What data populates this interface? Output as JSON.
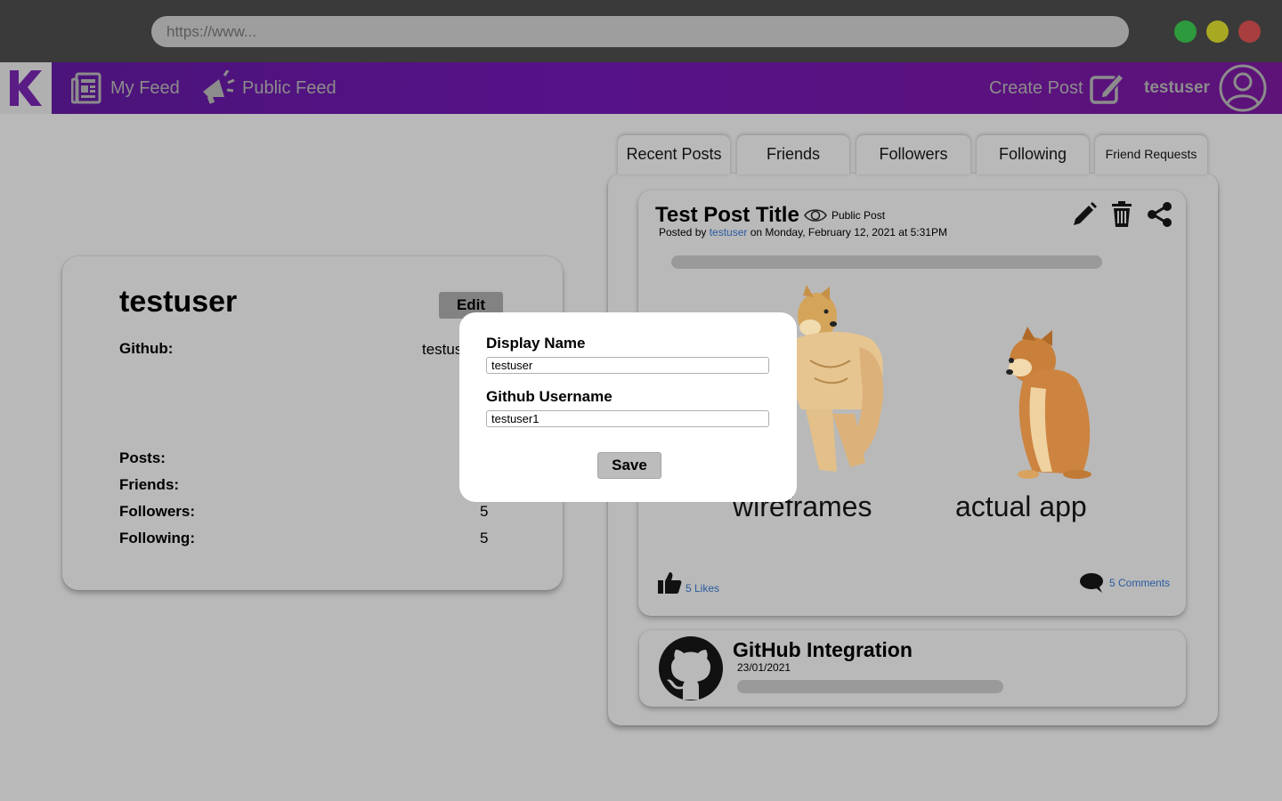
{
  "browser": {
    "url": "https://www...",
    "window_buttons": {
      "green": "#2d9a3d",
      "yellow": "#a8a823",
      "red": "#a83e3e"
    }
  },
  "navbar": {
    "logo_letter": "K",
    "my_feed_label": "My Feed",
    "public_feed_label": "Public Feed",
    "create_post_label": "Create Post",
    "username": "testuser",
    "gradient": [
      "#4a1478",
      "#5d1378"
    ]
  },
  "profile": {
    "name": "testuser",
    "edit_label": "Edit",
    "github_label": "Github:",
    "github_value": "testuser1",
    "posts_label": "Posts:",
    "friends_label": "Friends:",
    "followers_label": "Followers:",
    "followers_count": "5",
    "following_label": "Following:",
    "following_count": "5"
  },
  "tabs": [
    "Recent Posts",
    "Friends",
    "Followers",
    "Following",
    "Friend Requests"
  ],
  "post": {
    "title": "Test Post Title",
    "visibility": "Public Post",
    "posted_by_prefix": "Posted by ",
    "author": "testuser",
    "posted_on": " on Monday, February 12, 2021 at 5:31PM",
    "caption_left": "wireframes",
    "caption_right": "actual app",
    "likes": "5 Likes",
    "comments": "5 Comments"
  },
  "github_card": {
    "title": "GitHub Integration",
    "date": "23/01/2021"
  },
  "modal": {
    "display_name_label": "Display Name",
    "display_name_value": "testuser",
    "github_username_label": "Github Username",
    "github_username_value": "testuser1",
    "save_label": "Save"
  }
}
